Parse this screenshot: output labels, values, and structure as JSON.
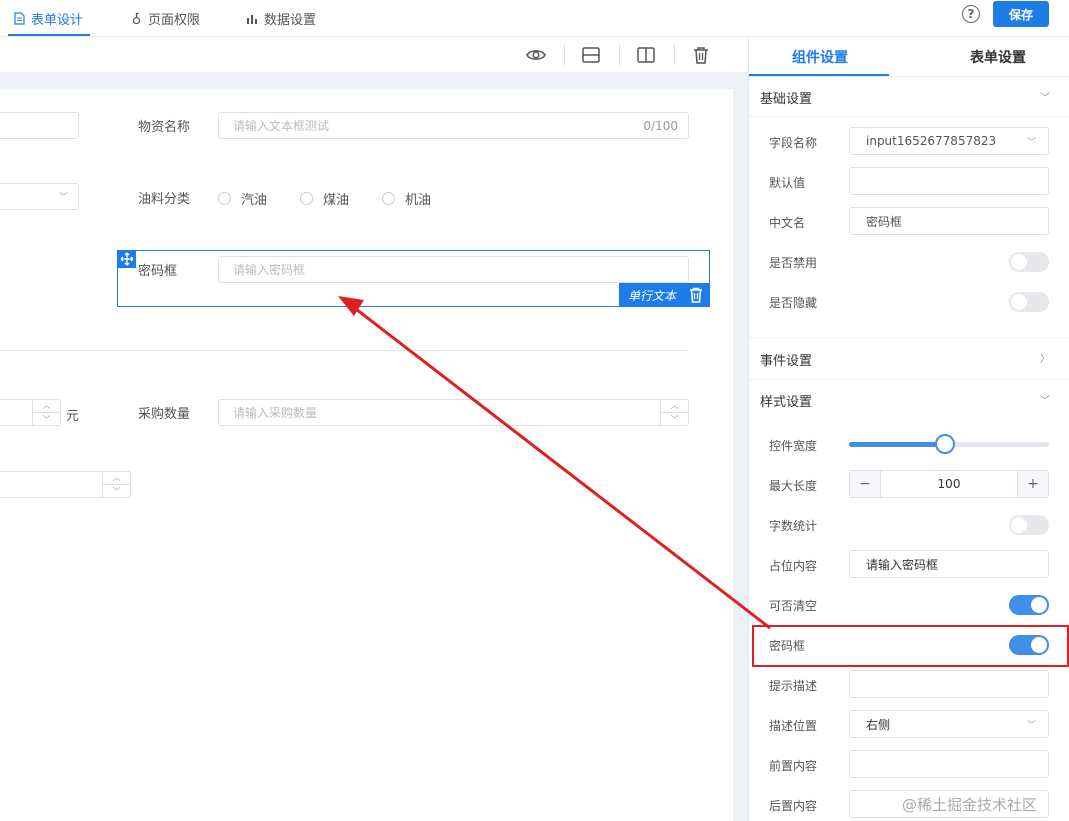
{
  "header": {
    "tabs": [
      {
        "label": "表单设计",
        "icon": "document-icon"
      },
      {
        "label": "页面权限",
        "icon": "lock-icon"
      },
      {
        "label": "数据设置",
        "icon": "bar-chart-icon"
      }
    ],
    "help_label": "?",
    "save_label": "保存"
  },
  "toolbar": {
    "icons": [
      "eye-icon",
      "row-layout-icon",
      "column-layout-icon",
      "trash-icon"
    ]
  },
  "form": {
    "material_name": {
      "label": "物资名称",
      "placeholder": "请输入文本框测试",
      "count": "0/100"
    },
    "oil_type": {
      "label": "油料分类",
      "options": [
        "汽油",
        "煤油",
        "机油"
      ]
    },
    "password": {
      "label": "密码框",
      "placeholder": "请输入密码框",
      "type_tag": "单行文本"
    },
    "price_unit": "元",
    "purchase_qty": {
      "label": "采购数量",
      "placeholder": "请输入采购数量"
    }
  },
  "right_panel": {
    "tabs": [
      "组件设置",
      "表单设置"
    ],
    "sections": {
      "basic": "基础设置",
      "events": "事件设置",
      "style": "样式设置"
    },
    "fields": {
      "field_name": {
        "label": "字段名称",
        "value": "input1652677857823"
      },
      "default_value": {
        "label": "默认值",
        "value": ""
      },
      "chinese_name": {
        "label": "中文名",
        "value": "密码框"
      },
      "disabled": {
        "label": "是否禁用",
        "on": false
      },
      "hidden": {
        "label": "是否隐藏",
        "on": false
      },
      "width": {
        "label": "控件宽度",
        "level": 0.48
      },
      "max_length": {
        "label": "最大长度",
        "value": "100",
        "minus": "−",
        "plus": "+"
      },
      "word_count": {
        "label": "字数统计",
        "on": false
      },
      "placeholder": {
        "label": "占位内容",
        "value": "请输入密码框"
      },
      "clearable": {
        "label": "可否清空",
        "on": true
      },
      "password": {
        "label": "密码框",
        "on": true
      },
      "hint": {
        "label": "提示描述",
        "value": ""
      },
      "desc_position": {
        "label": "描述位置",
        "value": "右侧"
      },
      "prefix": {
        "label": "前置内容",
        "value": ""
      },
      "suffix": {
        "label": "后置内容",
        "value": ""
      }
    }
  },
  "watermark": "@稀土掘金技术社区",
  "colors": {
    "accent": "#1e7ce8",
    "toggle_on": "#3f8ee8",
    "highlight": "#e02020"
  }
}
